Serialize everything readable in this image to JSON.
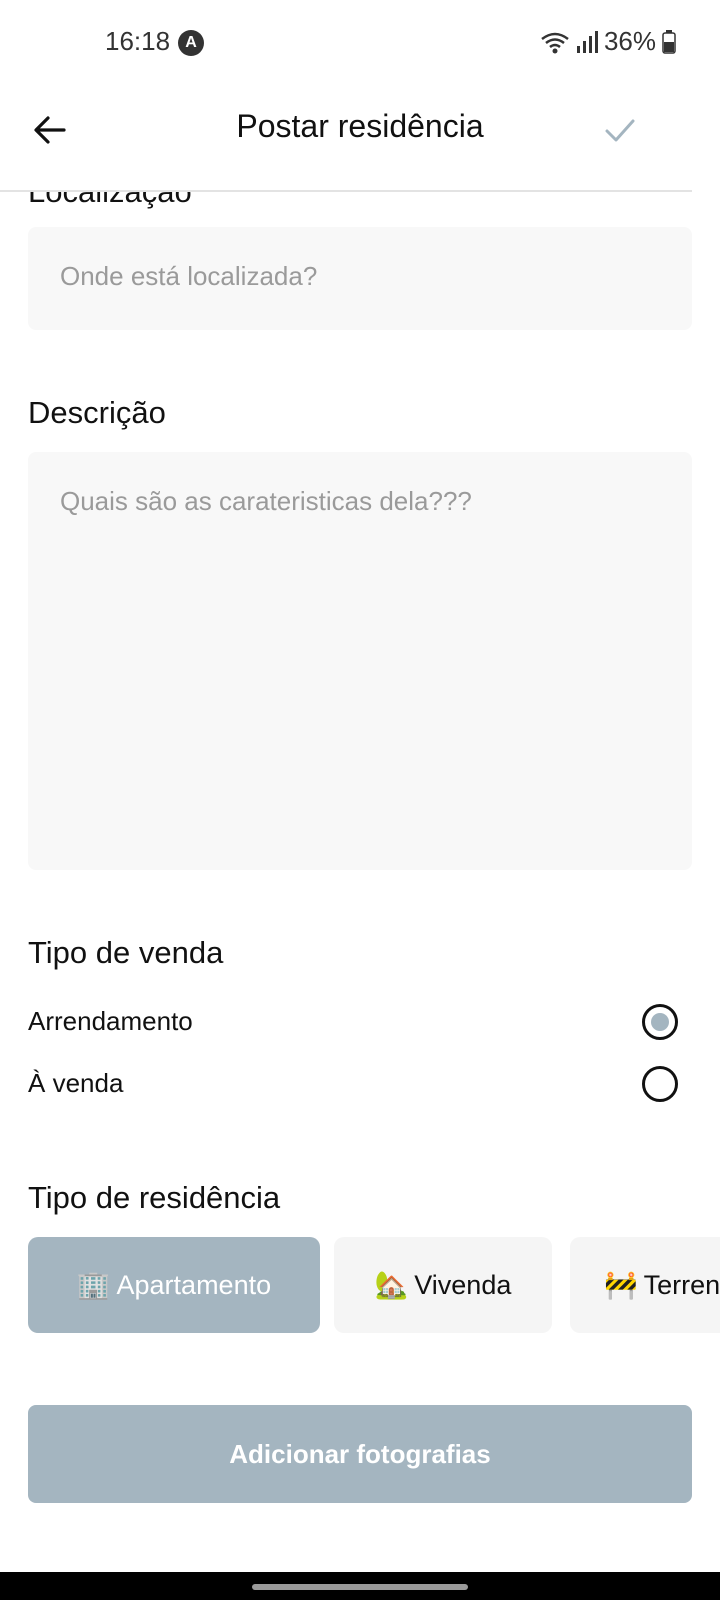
{
  "status_bar": {
    "time": "16:18",
    "app_icon": "A",
    "battery": "36%"
  },
  "header": {
    "title": "Postar residência",
    "back_icon": "arrow-left-icon",
    "confirm_icon": "check-icon"
  },
  "location": {
    "label": "Localização",
    "placeholder": "Onde está localizada?"
  },
  "description": {
    "label": "Descrição",
    "placeholder": "Quais são as carateristicas dela???"
  },
  "sale_type": {
    "label": "Tipo de venda",
    "options": [
      {
        "label": "Arrendamento",
        "selected": true
      },
      {
        "label": "À venda",
        "selected": false
      }
    ]
  },
  "residence_type": {
    "label": "Tipo de residência",
    "options": [
      {
        "emoji": "🏢",
        "label": "Apartamento",
        "selected": true
      },
      {
        "emoji": "🏡",
        "label": "Vivenda",
        "selected": false
      },
      {
        "emoji": "🚧",
        "label": "Terreno",
        "selected": false
      }
    ]
  },
  "add_photos_button": "Adicionar fotografias",
  "colors": {
    "accent": "#a4b5c0",
    "field_bg": "#f8f8f8",
    "chip_bg": "#f5f5f5"
  }
}
